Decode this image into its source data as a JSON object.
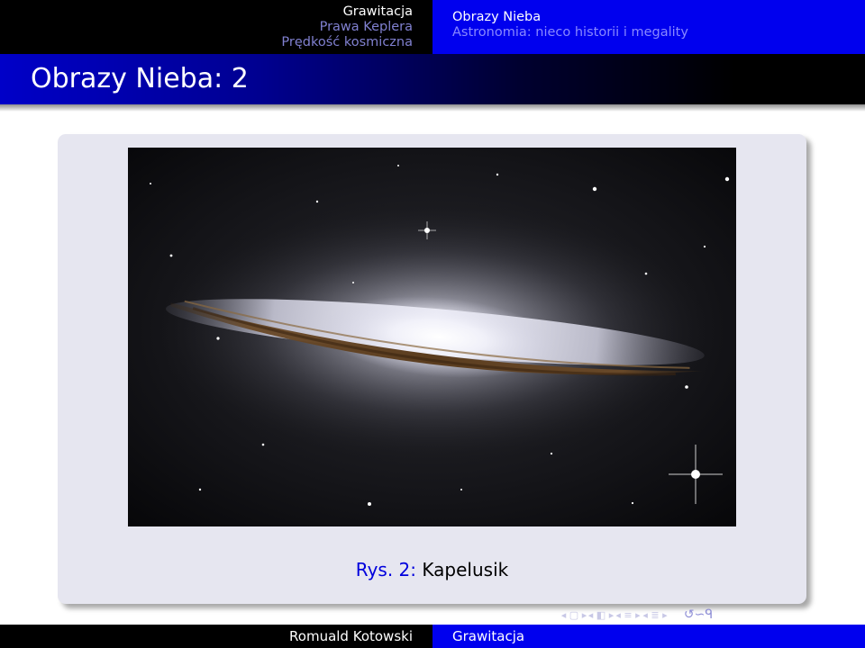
{
  "header": {
    "sections": [
      {
        "label": "Grawitacja",
        "active": true
      },
      {
        "label": "Prawa Keplera",
        "active": false
      },
      {
        "label": "Prędkość kosmiczna",
        "active": false
      }
    ],
    "subsections": [
      {
        "label": "Obrazy Nieba",
        "active": true
      },
      {
        "label": "Astronomia: nieco historii i megality",
        "active": false
      }
    ]
  },
  "frame": {
    "title": "Obrazy Nieba: 2"
  },
  "figure": {
    "caption_label": "Rys. 2:",
    "caption_text": "Kapelusik"
  },
  "navigation": {
    "icons": [
      "nav-frame-left-icon",
      "nav-frame-right-icon",
      "nav-subsection-icon",
      "nav-section-icon",
      "nav-subsection-left-icon",
      "nav-subsection-right-icon",
      "nav-search-icon"
    ],
    "glyphs": {
      "slide": "◂ ▢ ▸",
      "frame": "◂ ◧ ▸",
      "subsection": "◂ ≡ ▸",
      "section": "◂ ≣ ▸",
      "search": "↺∽ᑫ"
    }
  },
  "footer": {
    "author": "Romuald Kotowski",
    "title": "Grawitacja"
  },
  "colors": {
    "header_left": "#000000",
    "header_right": "#0000ee",
    "title_gradient_start": "#0000c8",
    "block_background": "#e6e6f0",
    "caption_label": "#0000dd"
  }
}
